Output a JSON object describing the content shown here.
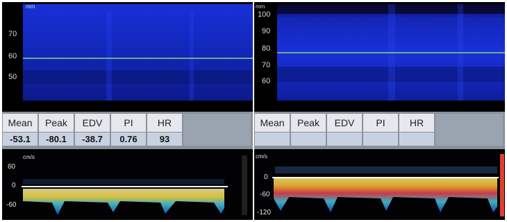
{
  "left": {
    "depth": {
      "unit": "mm",
      "ticks": [
        "70",
        "60",
        "50"
      ]
    },
    "table": {
      "headers": [
        "Mean",
        "Peak",
        "EDV",
        "PI",
        "HR"
      ],
      "values": [
        "-53.1",
        "-80.1",
        "-38.7",
        "0.76",
        "93"
      ]
    },
    "doppler": {
      "unit": "cm/s",
      "ticks": [
        "60",
        "0",
        "-60"
      ]
    }
  },
  "right": {
    "depth": {
      "unit": "mm",
      "ticks": [
        "100",
        "90",
        "80",
        "70",
        "60"
      ]
    },
    "table": {
      "headers": [
        "Mean",
        "Peak",
        "EDV",
        "PI",
        "HR"
      ],
      "values": [
        "",
        "",
        "",
        "",
        ""
      ]
    },
    "doppler": {
      "unit": "cm/s",
      "ticks": [
        "0",
        "-60",
        "-120"
      ]
    }
  },
  "colors": {
    "mmode_blue": "#1a2fd6",
    "gate_line": "#7fe07a",
    "baseline": "#ffffff"
  }
}
